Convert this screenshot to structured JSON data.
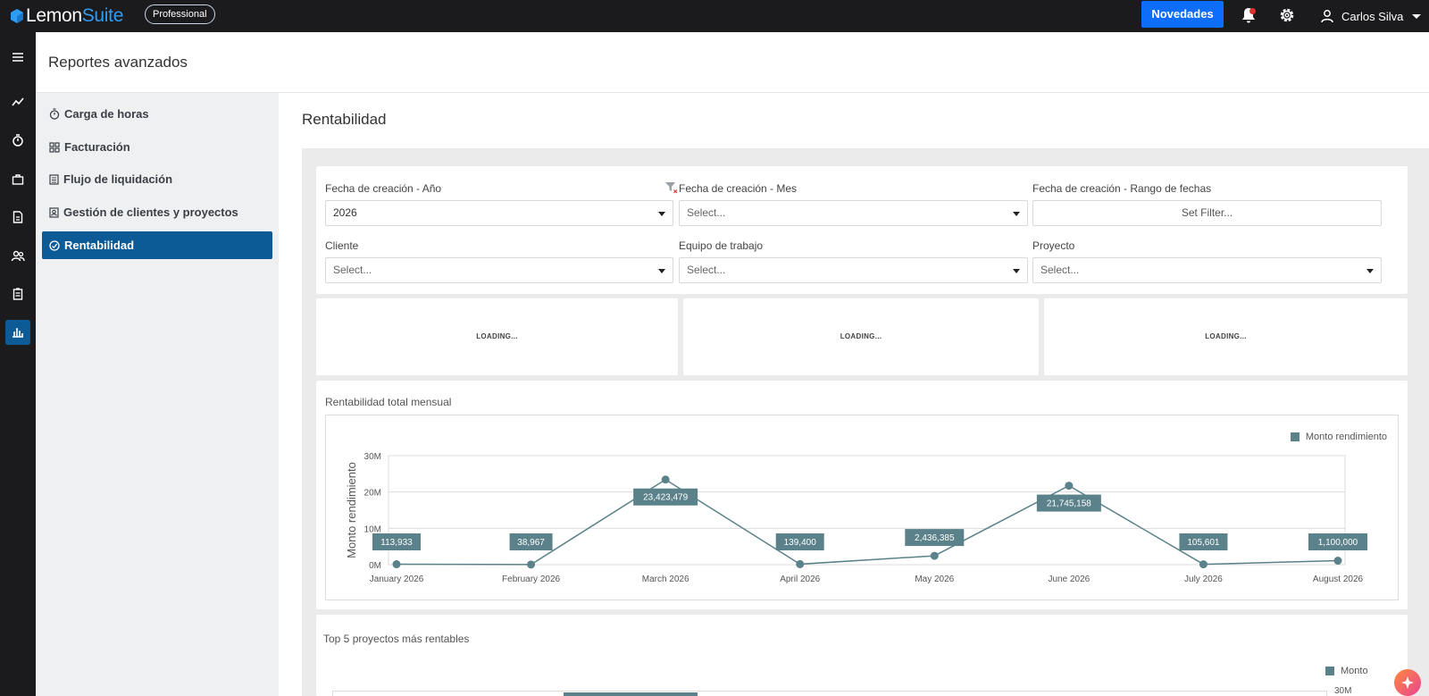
{
  "app": {
    "name_part1": "Lemon",
    "name_part2": "Suite",
    "plan": "Professional",
    "novedades": "Novedades",
    "user_name": "Carlos Silva"
  },
  "rail": {
    "icons": [
      "menu-icon",
      "trend-icon",
      "timer-icon",
      "briefcase-icon",
      "invoice-icon",
      "users-icon",
      "clipboard-icon",
      "bar-chart-icon"
    ],
    "active": "bar-chart-icon"
  },
  "header": {
    "title": "Reportes avanzados"
  },
  "submenu": {
    "items": [
      {
        "label": "Carga de horas",
        "icon": "stopwatch-icon"
      },
      {
        "label": "Facturación",
        "icon": "grid-icon"
      },
      {
        "label": "Flujo de liquidación",
        "icon": "document-icon"
      },
      {
        "label": "Gestión de clientes y proyectos",
        "icon": "contact-card-icon"
      },
      {
        "label": "Rentabilidad",
        "icon": "gauge-icon",
        "active": true
      }
    ]
  },
  "main": {
    "title": "Rentabilidad"
  },
  "filters": {
    "year_label": "Fecha de creación - Año",
    "year_value": "2026",
    "month_label": "Fecha de creación - Mes",
    "month_placeholder": "Select...",
    "range_label": "Fecha de creación - Rango de fechas",
    "range_button": "Set Filter...",
    "client_label": "Cliente",
    "client_placeholder": "Select...",
    "team_label": "Equipo de trabajo",
    "team_placeholder": "Select...",
    "project_label": "Proyecto",
    "project_placeholder": "Select..."
  },
  "kpis": [
    "LOADING...",
    "LOADING...",
    "LOADING..."
  ],
  "chart_title": "Rentabilidad total mensual",
  "bottom_title": "Top 5 proyectos más rentables",
  "bottom_legend": "Monto",
  "bottom_tick": "30M",
  "colors": {
    "accent": "#0c5a96",
    "series": "#5b828a",
    "novedades": "#0d6efd"
  },
  "chart_data": {
    "type": "line",
    "title": "Rentabilidad total mensual",
    "ylabel": "Monto rendimiento",
    "xlabel": "",
    "categories": [
      "January 2026",
      "February 2026",
      "March 2026",
      "April 2026",
      "May 2026",
      "June 2026",
      "July 2026",
      "August 2026"
    ],
    "series": [
      {
        "name": "Monto rendimiento",
        "values": [
          113933,
          38967,
          23423479,
          139400,
          2436385,
          21745158,
          105601,
          1100000
        ]
      }
    ],
    "data_labels": [
      "113,933",
      "38,967",
      "23,423,479",
      "139,400",
      "2,436,385",
      "21,745,158",
      "105,601",
      "1,100,000"
    ],
    "ylim": [
      0,
      30000000
    ],
    "yticks": [
      "0M",
      "10M",
      "20M",
      "30M"
    ],
    "grid": true,
    "legend": "top-right"
  }
}
